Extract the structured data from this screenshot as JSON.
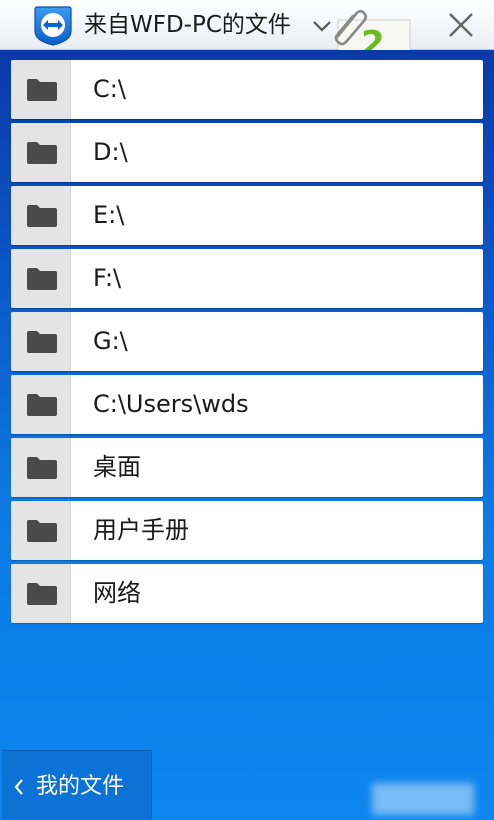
{
  "header": {
    "title": "来自WFD-PC的文件",
    "badge_count": "2",
    "app_icon": "teamviewer-icon",
    "dropdown_icon": "chevron-down-icon",
    "attachment_icon": "paperclip-icon",
    "close_icon": "close-icon"
  },
  "folders": [
    {
      "label": "C:\\"
    },
    {
      "label": "D:\\"
    },
    {
      "label": "E:\\"
    },
    {
      "label": "F:\\"
    },
    {
      "label": "G:\\"
    },
    {
      "label": "C:\\Users\\wds"
    },
    {
      "label": "桌面"
    },
    {
      "label": "用户手册"
    },
    {
      "label": "网络"
    }
  ],
  "footer": {
    "back_label": "我的文件"
  },
  "colors": {
    "background_top": "#0a3aa8",
    "background_bottom": "#0d86ef",
    "badge_number": "#6dbb1e",
    "folder_icon": "#4a4a4a"
  }
}
